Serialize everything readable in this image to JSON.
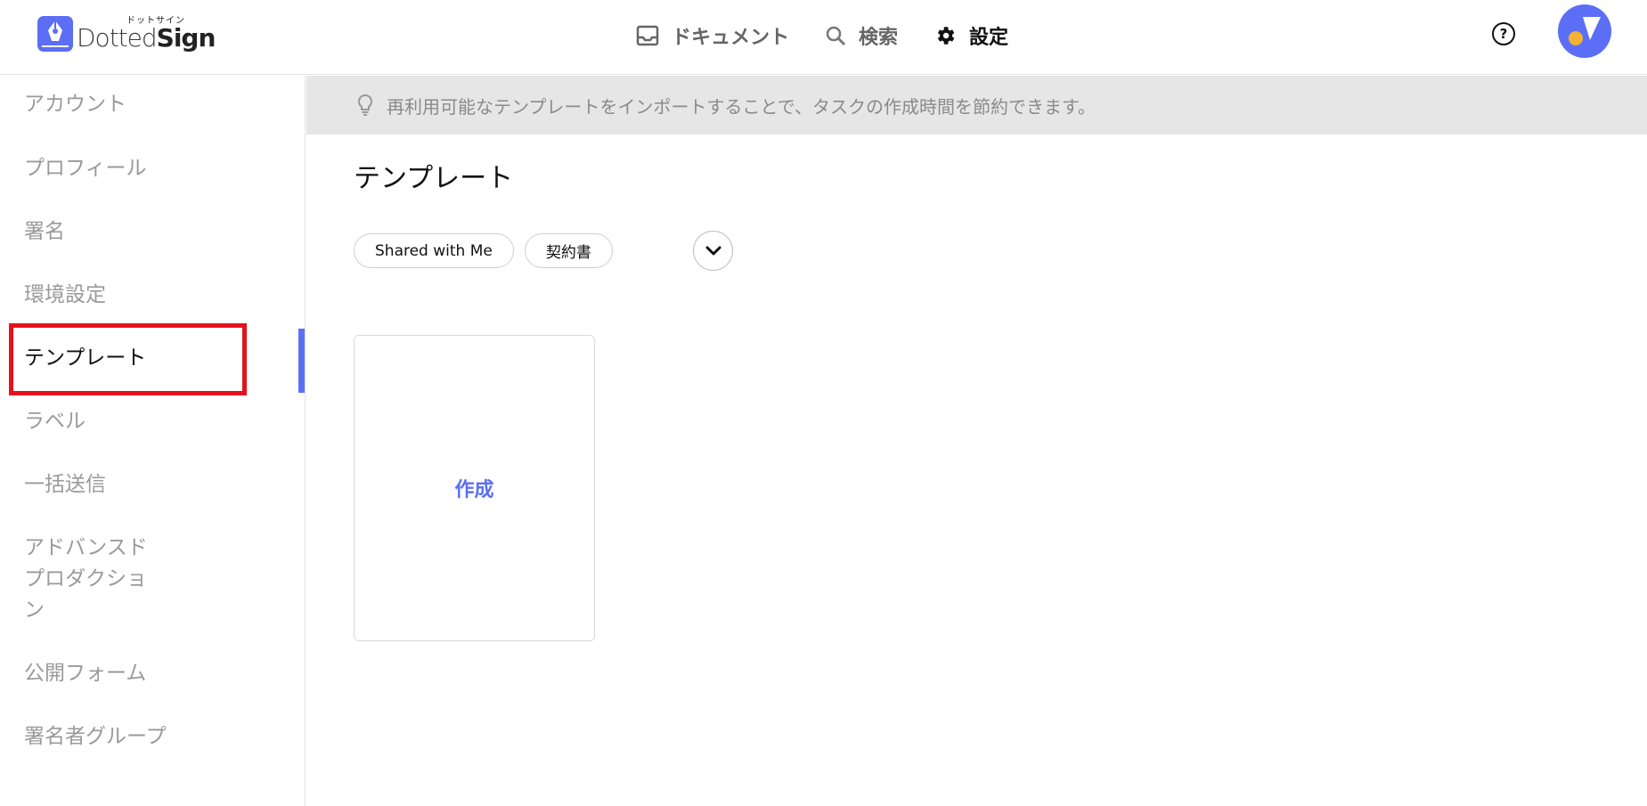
{
  "app": {
    "logo_small": "ドットサイン",
    "logo_name_light": "Dotted",
    "logo_name_bold": "Sign"
  },
  "nav": {
    "documents": "ドキュメント",
    "search": "検索",
    "settings": "設定",
    "active": "settings"
  },
  "header": {
    "help_glyph": "?"
  },
  "sidebar": {
    "items": [
      {
        "label": "アカウント"
      },
      {
        "label": "プロフィール"
      },
      {
        "label": "署名"
      },
      {
        "label": "環境設定"
      },
      {
        "label": "テンプレート"
      },
      {
        "label": "ラベル"
      },
      {
        "label": "一括送信"
      },
      {
        "label_lines": [
          "アドバンスド",
          "プロダクショ",
          "ン"
        ]
      },
      {
        "label": "公開フォーム"
      },
      {
        "label": "署名者グループ"
      }
    ],
    "active_index": 4
  },
  "tip": {
    "text": "再利用可能なテンプレートをインポートすることで、タスクの作成時間を節約できます。"
  },
  "main": {
    "title": "テンプレート",
    "chips": [
      "Shared with Me",
      "契約書"
    ],
    "create_label": "作成"
  },
  "colors": {
    "accent": "#5b6ef5",
    "highlight": "#e4121b",
    "tip_bg": "#e6e6e6",
    "avatar_dot": "#f2b233"
  }
}
